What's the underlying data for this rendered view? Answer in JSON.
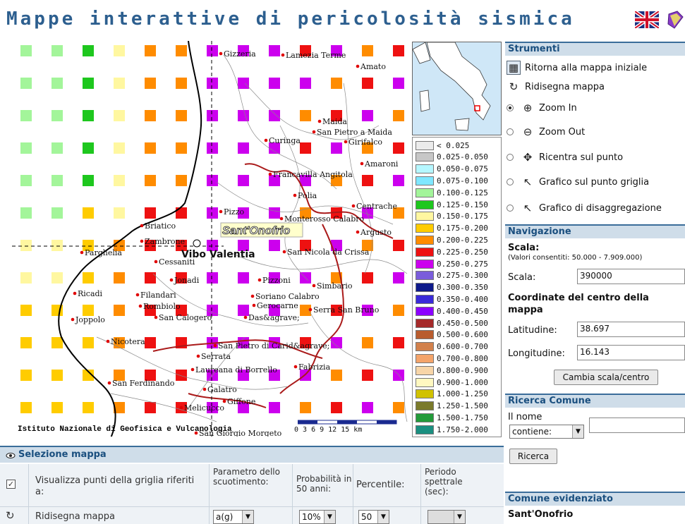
{
  "header": {
    "title": "Mappe interattive di pericolosità sismica",
    "language_icon": "uk-flag-icon",
    "help_icon": "book-icon"
  },
  "map": {
    "highlighted_town": "Sant'Onofrio",
    "main_town": "Vibo Valentia",
    "towns": [
      "Gizzeria",
      "Lamezia Terme",
      "Amato",
      "Maida",
      "San Pietro a Maida",
      "Curinga",
      "Girifalco",
      "Amaroni",
      "Francavilla Angitola",
      "Polia",
      "Centrache",
      "Pizzo",
      "Monterosso Calabro",
      "Argusto",
      "Briatico",
      "Zambrone",
      "Parghelia",
      "Cessaniti",
      "San Nicola da Crissa",
      "Jonadi",
      "Pizzoni",
      "Simbario",
      "Ricadi",
      "Filandari",
      "Rombiolo",
      "Soriano Calabro",
      "Gerocarne",
      "Serra San Bruno",
      "Joppolo",
      "San Calogero",
      "Das&agrave;",
      "Nicotera",
      "San Pietro di Carid&agrave;",
      "Serrata",
      "Fabrizia",
      "Laureana di Borrello",
      "San Ferdinando",
      "Galatro",
      "Giffone",
      "Melicucco",
      "San Giorgio Morgeto"
    ],
    "credit": "Istituto Nazionale di Geofisica e Vulcanologia",
    "scale_ticks": [
      "0",
      "3",
      "6",
      "9",
      "12",
      "15 km"
    ]
  },
  "legend": {
    "rows": [
      {
        "label": "< 0.025",
        "color": "#ebebeb"
      },
      {
        "label": "0.025-0.050",
        "color": "#c7c7c7"
      },
      {
        "label": "0.050-0.075",
        "color": "#b5f7ff"
      },
      {
        "label": "0.075-0.100",
        "color": "#7fe7ff"
      },
      {
        "label": "0.100-0.125",
        "color": "#a3f59a"
      },
      {
        "label": "0.125-0.150",
        "color": "#1ec71e"
      },
      {
        "label": "0.150-0.175",
        "color": "#fff7a0"
      },
      {
        "label": "0.175-0.200",
        "color": "#ffcc00"
      },
      {
        "label": "0.200-0.225",
        "color": "#ff8c00"
      },
      {
        "label": "0.225-0.250",
        "color": "#ee1111"
      },
      {
        "label": "0.250-0.275",
        "color": "#cc00ee"
      },
      {
        "label": "0.275-0.300",
        "color": "#7a5cdb"
      },
      {
        "label": "0.300-0.350",
        "color": "#0e1a8a"
      },
      {
        "label": "0.350-0.400",
        "color": "#3a2bd9"
      },
      {
        "label": "0.400-0.450",
        "color": "#8b00ff"
      },
      {
        "label": "0.450-0.500",
        "color": "#a52a2a"
      },
      {
        "label": "0.500-0.600",
        "color": "#b95c2e"
      },
      {
        "label": "0.600-0.700",
        "color": "#d2814c"
      },
      {
        "label": "0.700-0.800",
        "color": "#f4a46a"
      },
      {
        "label": "0.800-0.900",
        "color": "#f7d5a8"
      },
      {
        "label": "0.900-1.000",
        "color": "#fff8c0"
      },
      {
        "label": "1.000-1.250",
        "color": "#d1c200"
      },
      {
        "label": "1.250-1.500",
        "color": "#7a7a2a"
      },
      {
        "label": "1.500-1.750",
        "color": "#239b3a"
      },
      {
        "label": "1.750-2.000",
        "color": "#1a8f80"
      }
    ]
  },
  "tools": {
    "title": "Strumenti",
    "reset": "Ritorna alla mappa iniziale",
    "redraw": "Ridisegna mappa",
    "zoom_in": "Zoom In",
    "zoom_out": "Zoom Out",
    "recenter": "Ricentra sul punto",
    "grid_graph": "Grafico sul punto griglia",
    "disagg_graph": "Grafico di disaggregazione"
  },
  "navigation": {
    "title": "Navigazione",
    "scale_title": "Scala:",
    "scale_note": "(Valori consentiti: 50.000 - 7.909.000)",
    "scale_label": "Scala:",
    "scale_value": "390000",
    "coords_title": "Coordinate del centro della mappa",
    "lat_label": "Latitudine:",
    "lat_value": "38.697",
    "lon_label": "Longitudine:",
    "lon_value": "16.143",
    "apply_button": "Cambia scala/centro"
  },
  "search": {
    "title": "Ricerca Comune",
    "name_label": "Il nome",
    "mode_value": "contiene:",
    "query_value": "",
    "button": "Ricerca"
  },
  "highlighted": {
    "title": "Comune evidenziato",
    "name": "Sant'Onofrio"
  },
  "selection": {
    "title": "Selezione mappa",
    "grid_points_label": "Visualizza punti della griglia riferiti a:",
    "param_header": "Parametro dello scuotimento:",
    "prob_header": "Probabilità in 50 anni:",
    "percentile_header": "Percentile:",
    "period_header": "Periodo spettrale (sec):",
    "redraw_label": "Ridisegna mappa",
    "param_value": "a(g)",
    "prob_value": "10%",
    "percentile_value": "50",
    "period_value": ""
  }
}
